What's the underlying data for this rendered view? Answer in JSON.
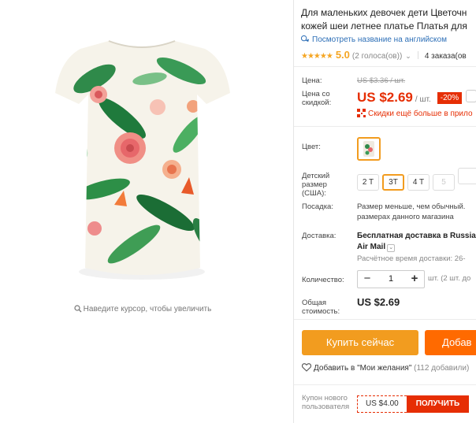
{
  "product": {
    "title_line1": "Для маленьких девочек дети Цветочн",
    "title_line2": "кожей шеи летнее платье Платья для",
    "translate_link": "Посмотреть название на английском",
    "rating_stars": "★★★★★",
    "rating_value": "5.0",
    "votes": "(2 голоса(ов))",
    "orders": "4 заказа(ов"
  },
  "gallery": {
    "zoom_hint": "Наведите курсор, чтобы увеличить"
  },
  "pricing": {
    "price_label": "Цена:",
    "old_price": "US $3.36 / шт.",
    "discount_price_label": "Цена со скидкой:",
    "price": "US $2.69",
    "per_unit": "/ шт.",
    "discount_badge": "-20%",
    "more_discounts": "Скидки ещё больше в прило"
  },
  "options": {
    "color_label": "Цвет:",
    "size_label": "Детский размер (США):",
    "sizes": [
      "2 T",
      "3T",
      "4 T",
      "5"
    ],
    "selected_size": "3T",
    "fit_label": "Посадка:",
    "fit_text": "Размер меньше, чем обычный. размерах данного магазина"
  },
  "shipping": {
    "label": "Доставка:",
    "method_line1": "Бесплатная доставка в Russia",
    "method_line2": "Air Mail",
    "estimate": "Расчётное время доставки: 26-"
  },
  "quantity": {
    "label": "Количество:",
    "value": "1",
    "minus": "−",
    "plus": "+",
    "note": "шт. (2 шт. до"
  },
  "total": {
    "label": "Общая стоимость:",
    "value": "US $2.69"
  },
  "actions": {
    "buy_now": "Купить сейчас",
    "add_to_cart": "Добав",
    "wishlist": "Добавить в \"Мои желания\"",
    "wishlist_count": "(112 добавили)"
  },
  "coupon": {
    "label": "Купон нового пользователя",
    "amount": "US $4.00",
    "get": "ПОЛУЧИТЬ"
  },
  "colors": {
    "accent": "#e62e04",
    "orange": "#f29c1f",
    "link": "#2d6fb7",
    "star": "#f5a623"
  }
}
